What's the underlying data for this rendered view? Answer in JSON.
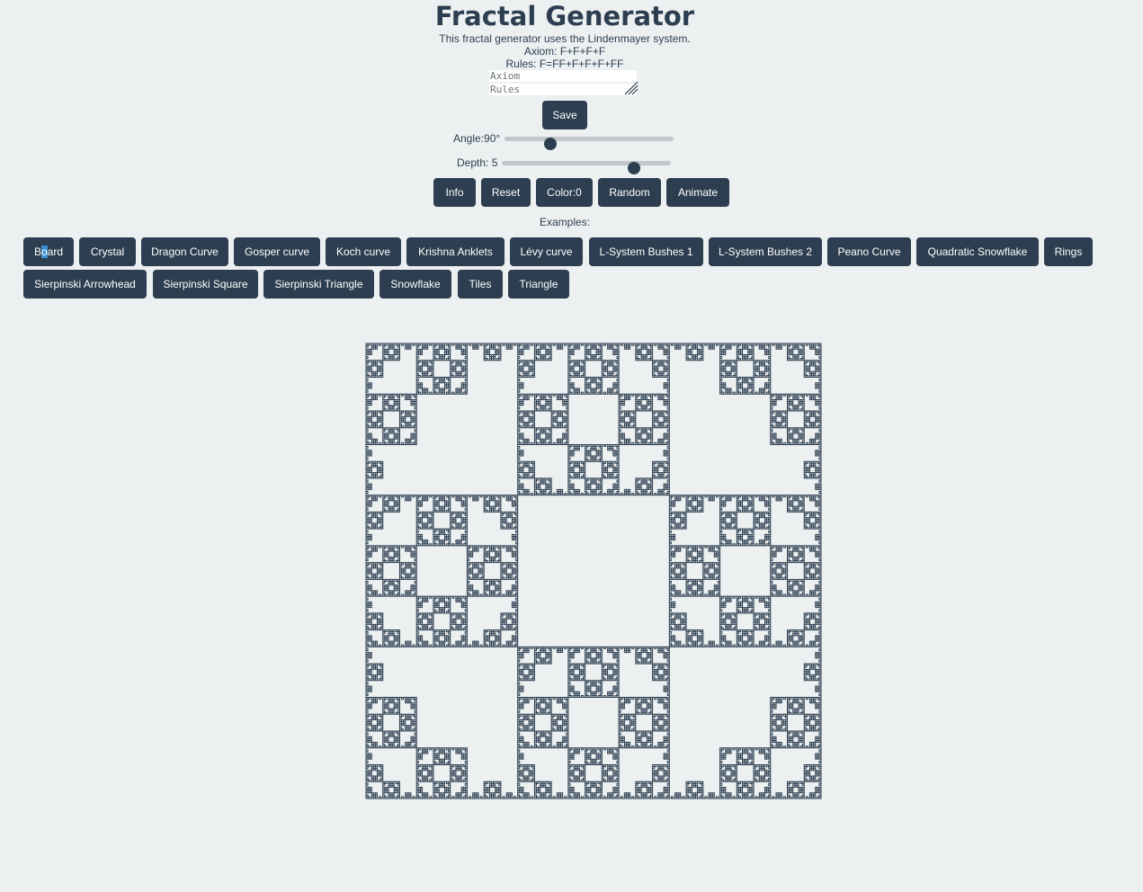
{
  "title": "Fractal Generator",
  "description": "This fractal generator uses the Lindenmayer system.",
  "axiom_text": "Axiom: F+F+F+F",
  "rules_text": "Rules: F=FF+F+F+F+FF",
  "inputs": {
    "axiom_placeholder": "Axiom",
    "rules_placeholder": "Rules",
    "save_label": "Save"
  },
  "controls": {
    "angle_label": "Angle:90°",
    "angle_value": 90,
    "angle_fraction": 0.27,
    "depth_label": "Depth: 5",
    "depth_value": 5,
    "depth_fraction": 0.78
  },
  "buttons": {
    "info": "Info",
    "reset": "Reset",
    "color": "Color:0",
    "random": "Random",
    "animate": "Animate"
  },
  "examples_label": "Examples:",
  "examples": [
    "Board",
    "Crystal",
    "Dragon Curve",
    "Gosper curve",
    "Koch curve",
    "Krishna Anklets",
    "Lévy curve",
    "L-System Bushes 1",
    "L-System Bushes 2",
    "Peano Curve",
    "Quadratic Snowflake",
    "Rings",
    "Sierpinski Arrowhead",
    "Sierpinski Square",
    "Sierpinski Triangle",
    "Snowflake",
    "Tiles",
    "Triangle"
  ],
  "colors": {
    "background": "#ecf0f1",
    "primary": "#2c3e50",
    "track": "#c3c7ca"
  }
}
